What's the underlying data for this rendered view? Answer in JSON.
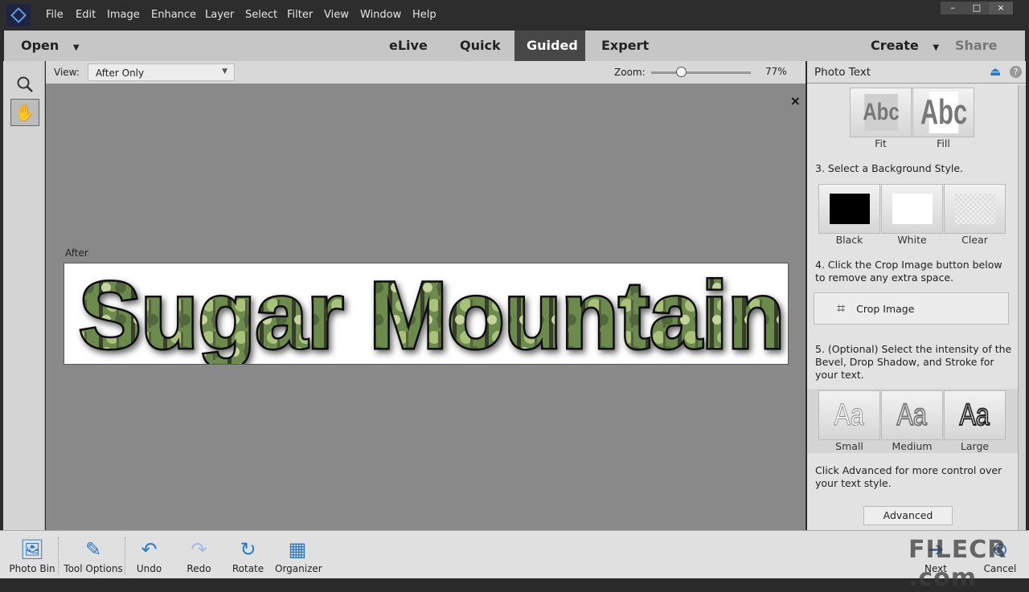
{
  "menu": [
    "File",
    "Edit",
    "Image",
    "Enhance",
    "Layer",
    "Select",
    "Filter",
    "View",
    "Window",
    "Help"
  ],
  "window_controls": [
    "–",
    "□",
    "×"
  ],
  "modebar": {
    "open": "Open",
    "modes": [
      "eLive",
      "Quick",
      "Guided",
      "Expert"
    ],
    "active": "Guided",
    "create": "Create",
    "share": "Share"
  },
  "viewbar": {
    "view_label": "View:",
    "view_value": "After Only",
    "zoom_label": "Zoom:",
    "zoom_value": "77%",
    "zoom_fraction": 0.3
  },
  "canvas": {
    "after_label": "After",
    "banner_text": "Sugar Mountain",
    "close": "×"
  },
  "panel": {
    "title": "Photo Text",
    "fit_options": [
      {
        "label": "Fit",
        "preview": "Abc"
      },
      {
        "label": "Fill",
        "preview": "Abc"
      }
    ],
    "step3": "3. Select a Background Style.",
    "backgrounds": [
      {
        "label": "Black",
        "color": "#000000"
      },
      {
        "label": "White",
        "color": "#ffffff"
      },
      {
        "label": "Clear",
        "color": "#e8e8e8"
      }
    ],
    "step4": "4. Click the Crop Image button below to remove any extra space.",
    "crop_button": "Crop Image",
    "step5": "5. (Optional) Select the intensity of the Bevel, Drop Shadow, and Stroke for your text.",
    "intensity": [
      {
        "label": "Small",
        "preview": "Aa"
      },
      {
        "label": "Medium",
        "preview": "Aa"
      },
      {
        "label": "Large",
        "preview": "Aa"
      }
    ],
    "advanced_text": "Click Advanced for more control over your text style.",
    "advanced_button": "Advanced"
  },
  "bottombar": {
    "items": [
      {
        "label": "Photo Bin"
      },
      {
        "label": "Tool Options"
      },
      {
        "label": "Undo"
      },
      {
        "label": "Redo"
      },
      {
        "label": "Rotate"
      },
      {
        "label": "Organizer"
      }
    ],
    "next": "Next",
    "cancel": "Cancel"
  },
  "watermark": "FILECR .com",
  "colors": {
    "accent": "#2b78c5",
    "active_mode": "#474747"
  }
}
